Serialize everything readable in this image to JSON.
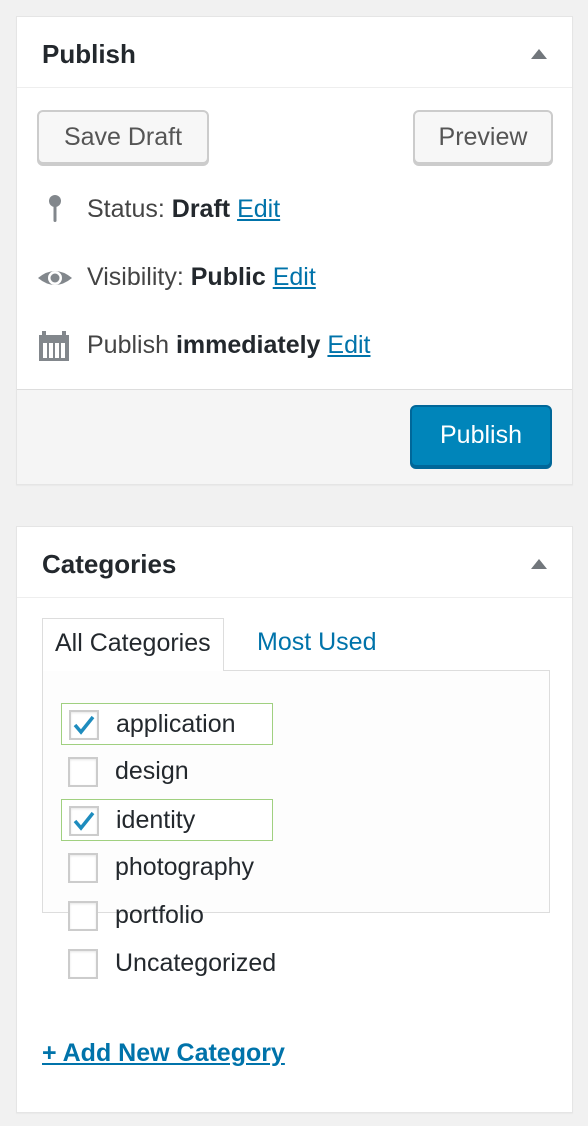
{
  "publish": {
    "title": "Publish",
    "save_draft_label": "Save Draft",
    "preview_label": "Preview",
    "status": {
      "label": "Status: ",
      "value": "Draft",
      "edit": "Edit"
    },
    "visibility": {
      "label": "Visibility: ",
      "value": "Public",
      "edit": "Edit"
    },
    "schedule": {
      "label": "Publish ",
      "value": "immediately",
      "edit": "Edit"
    },
    "publish_label": "Publish",
    "icons": {
      "status": "pin-icon",
      "visibility": "eye-icon",
      "schedule": "calendar-icon",
      "toggle": "triangle-up-icon"
    }
  },
  "categories": {
    "title": "Categories",
    "tabs": [
      {
        "label": "All Categories",
        "active": true
      },
      {
        "label": "Most Used",
        "active": false
      }
    ],
    "items": [
      {
        "label": "application",
        "checked": true
      },
      {
        "label": "design",
        "checked": false
      },
      {
        "label": "identity",
        "checked": true
      },
      {
        "label": "photography",
        "checked": false
      },
      {
        "label": "portfolio",
        "checked": false
      },
      {
        "label": "Uncategorized",
        "checked": false
      }
    ],
    "add_new_label": "+ Add New Category"
  },
  "colors": {
    "primary_button": "#0085ba",
    "link": "#0073aa",
    "checkmark": "#1e8cbe",
    "checked_outline": "#a0d080"
  }
}
